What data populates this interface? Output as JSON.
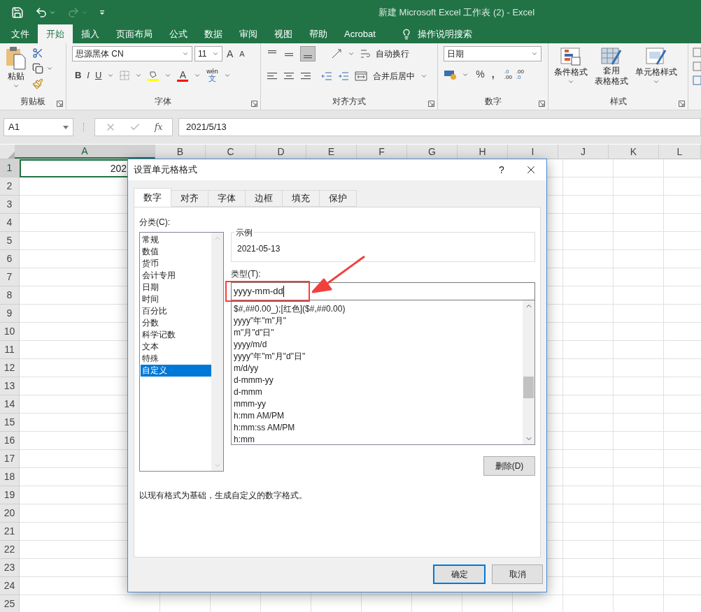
{
  "window": {
    "title": "新建 Microsoft Excel 工作表 (2)  -  Excel"
  },
  "menu_tabs": [
    {
      "label": "文件",
      "selected": false
    },
    {
      "label": "开始",
      "selected": true
    },
    {
      "label": "插入",
      "selected": false
    },
    {
      "label": "页面布局",
      "selected": false
    },
    {
      "label": "公式",
      "selected": false
    },
    {
      "label": "数据",
      "selected": false
    },
    {
      "label": "审阅",
      "selected": false
    },
    {
      "label": "视图",
      "selected": false
    },
    {
      "label": "帮助",
      "selected": false
    },
    {
      "label": "Acrobat",
      "selected": false
    }
  ],
  "tell_me": "操作说明搜索",
  "ribbon": {
    "clipboard": {
      "paste": "粘贴",
      "group": "剪贴板"
    },
    "font": {
      "name": "思源黑体 CN",
      "size": "11",
      "grow": "A",
      "shrink": "A",
      "bold": "B",
      "italic": "I",
      "underline": "U",
      "font_color": "A",
      "phonetic_top": "wén",
      "phonetic_bottom": "文",
      "group": "字体"
    },
    "alignment": {
      "wrap": "自动换行",
      "merge": "合并后居中",
      "group": "对齐方式"
    },
    "number": {
      "format": "日期",
      "percent": "%",
      "comma": ",",
      "inc_top": ".0",
      "inc_bottom": ".00",
      "dec_top": ".00",
      "dec_bottom": ".0",
      "group": "数字"
    },
    "styles": {
      "conditional": "条件格式",
      "table_top": "套用",
      "table_bottom": "表格格式",
      "cell_styles": "单元格样式",
      "group": "样式"
    }
  },
  "formula_bar": {
    "name_box": "A1",
    "fx": "fx",
    "formula": "2021/5/13"
  },
  "sheet": {
    "columns": [
      {
        "label": "A",
        "selected": true
      },
      {
        "label": "B",
        "selected": false
      },
      {
        "label": "C",
        "selected": false
      },
      {
        "label": "D",
        "selected": false
      },
      {
        "label": "E",
        "selected": false
      },
      {
        "label": "F",
        "selected": false
      },
      {
        "label": "G",
        "selected": false
      },
      {
        "label": "H",
        "selected": false
      },
      {
        "label": "I",
        "selected": false
      },
      {
        "label": "J",
        "selected": false
      },
      {
        "label": "K",
        "selected": false
      },
      {
        "label": "L",
        "selected": false
      }
    ],
    "rows": [
      {
        "label": "1",
        "selected": true
      },
      {
        "label": "2",
        "selected": false
      },
      {
        "label": "3",
        "selected": false
      },
      {
        "label": "4",
        "selected": false
      },
      {
        "label": "5",
        "selected": false
      },
      {
        "label": "6",
        "selected": false
      },
      {
        "label": "7",
        "selected": false
      },
      {
        "label": "8",
        "selected": false
      },
      {
        "label": "9",
        "selected": false
      },
      {
        "label": "10",
        "selected": false
      },
      {
        "label": "11",
        "selected": false
      },
      {
        "label": "12",
        "selected": false
      },
      {
        "label": "13",
        "selected": false
      },
      {
        "label": "14",
        "selected": false
      },
      {
        "label": "15",
        "selected": false
      },
      {
        "label": "16",
        "selected": false
      },
      {
        "label": "17",
        "selected": false
      },
      {
        "label": "18",
        "selected": false
      },
      {
        "label": "19",
        "selected": false
      },
      {
        "label": "20",
        "selected": false
      },
      {
        "label": "21",
        "selected": false
      },
      {
        "label": "22",
        "selected": false
      },
      {
        "label": "23",
        "selected": false
      },
      {
        "label": "24",
        "selected": false
      },
      {
        "label": "25",
        "selected": false
      }
    ],
    "a1_value": "202"
  },
  "dialog": {
    "title": "设置单元格格式",
    "help": "?",
    "tabs": [
      {
        "label": "数字",
        "selected": true
      },
      {
        "label": "对齐",
        "selected": false
      },
      {
        "label": "字体",
        "selected": false
      },
      {
        "label": "边框",
        "selected": false
      },
      {
        "label": "填充",
        "selected": false
      },
      {
        "label": "保护",
        "selected": false
      }
    ],
    "category_label": "分类(C):",
    "categories": [
      {
        "label": "常规",
        "selected": false
      },
      {
        "label": "数值",
        "selected": false
      },
      {
        "label": "货币",
        "selected": false
      },
      {
        "label": "会计专用",
        "selected": false
      },
      {
        "label": "日期",
        "selected": false
      },
      {
        "label": "时间",
        "selected": false
      },
      {
        "label": "百分比",
        "selected": false
      },
      {
        "label": "分数",
        "selected": false
      },
      {
        "label": "科学记数",
        "selected": false
      },
      {
        "label": "文本",
        "selected": false
      },
      {
        "label": "特殊",
        "selected": false
      },
      {
        "label": "自定义",
        "selected": true
      }
    ],
    "sample_label": "示例",
    "sample_value": "2021-05-13",
    "type_label": "类型(T):",
    "type_value": "yyyy-mm-dd",
    "formats": [
      "$#,##0.00_);[红色]($#,##0.00)",
      "yyyy\"年\"m\"月\"",
      "m\"月\"d\"日\"",
      "yyyy/m/d",
      "yyyy\"年\"m\"月\"d\"日\"",
      "m/d/yy",
      "d-mmm-yy",
      "d-mmm",
      "mmm-yy",
      "h:mm AM/PM",
      "h:mm:ss AM/PM",
      "h:mm"
    ],
    "delete": "删除(D)",
    "description": "以现有格式为基础，生成自定义的数字格式。",
    "ok": "确定",
    "cancel": "取消"
  }
}
